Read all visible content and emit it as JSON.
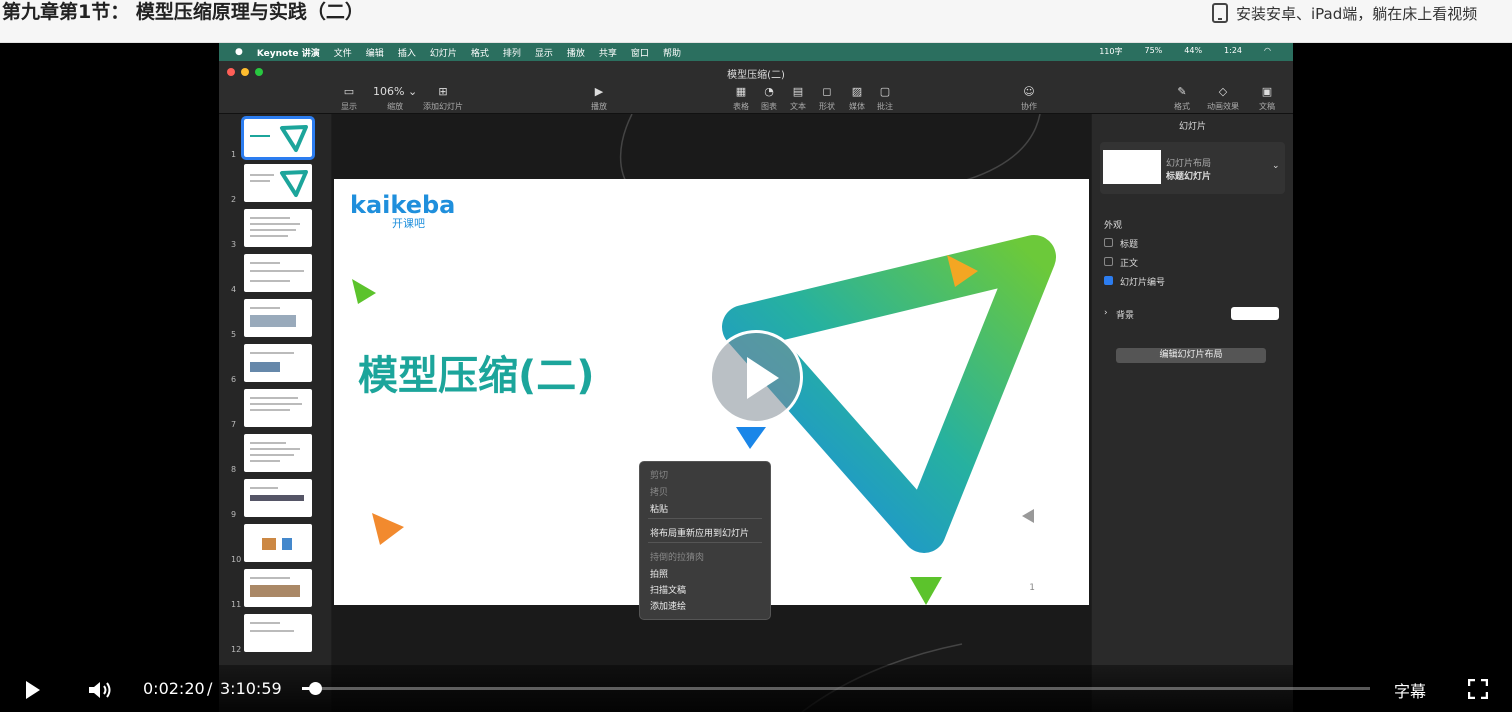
{
  "page": {
    "chapter_title": "第九章第1节： 模型压缩原理与实践（二）",
    "app_promo": "安装安卓、iPad端，躺在床上看视频"
  },
  "mac": {
    "menu": [
      "Keynote 讲演",
      "文件",
      "编辑",
      "插入",
      "幻灯片",
      "格式",
      "排列",
      "显示",
      "播放",
      "共享",
      "窗口",
      "帮助"
    ],
    "status": [
      "110字",
      "75%",
      "44%",
      "1:24"
    ]
  },
  "keynote": {
    "doc_title": "模型压缩(二)",
    "toolbar": {
      "view": "显示",
      "zoom": "106% ⌄",
      "zoom_label": "缩放",
      "add_slide": "添加幻灯片",
      "play": "播放",
      "table": "表格",
      "chart": "图表",
      "text": "文本",
      "shape": "形状",
      "media": "媒体",
      "comment": "批注",
      "collab": "协作",
      "format": "格式",
      "animate": "动画效果",
      "document": "文稿"
    },
    "slide_numbers": [
      "1",
      "2",
      "3",
      "4",
      "5",
      "6",
      "7",
      "8",
      "9",
      "10",
      "11",
      "12"
    ],
    "slide": {
      "logo": "kaikeba",
      "logo_sub": "开课吧",
      "title": "模型压缩(二)",
      "number": "1"
    },
    "context_menu": {
      "cut": "剪切",
      "copy": "拷贝",
      "paste": "粘贴",
      "reapply": "将布局重新应用到幻灯片",
      "hidden": "持倒的拉猜肉",
      "photo": "拍照",
      "scan": "扫描文稿",
      "sketch": "添加速绘"
    },
    "inspector": {
      "tab": "幻灯片",
      "layout_label": "幻灯片布局",
      "layout_name": "标题幻灯片",
      "appearance": "外观",
      "opt_title": "标题",
      "opt_body": "正文",
      "opt_number": "幻灯片编号",
      "background": "背景",
      "edit_layout": "编辑幻灯片布局"
    }
  },
  "player": {
    "current_time": "0:02:20",
    "separator": "/",
    "duration": "3:10:59",
    "progress": 0.012,
    "subtitles": "字幕",
    "colors": {
      "accent": "#1ca59b",
      "brand_blue": "#1f8fdc"
    }
  }
}
